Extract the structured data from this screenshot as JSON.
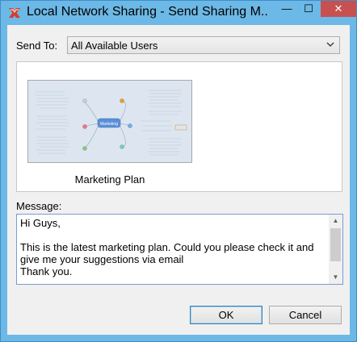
{
  "window": {
    "title": "Local Network Sharing - Send Sharing M...",
    "minimize_glyph": "—",
    "maximize_glyph": "☐",
    "close_glyph": "✕",
    "app_icon": "xmind-logo-icon",
    "accent": "#d83b2b"
  },
  "send_to": {
    "label": "Send To:",
    "value": "All Available Users"
  },
  "preview": {
    "caption": "Marketing Plan",
    "central_topic": "Marketing"
  },
  "message": {
    "label": "Message:",
    "value": "Hi Guys,\n\nThis is the latest marketing plan. Could you please check it and give me your suggestions via email\nThank you."
  },
  "buttons": {
    "ok": "OK",
    "cancel": "Cancel"
  }
}
